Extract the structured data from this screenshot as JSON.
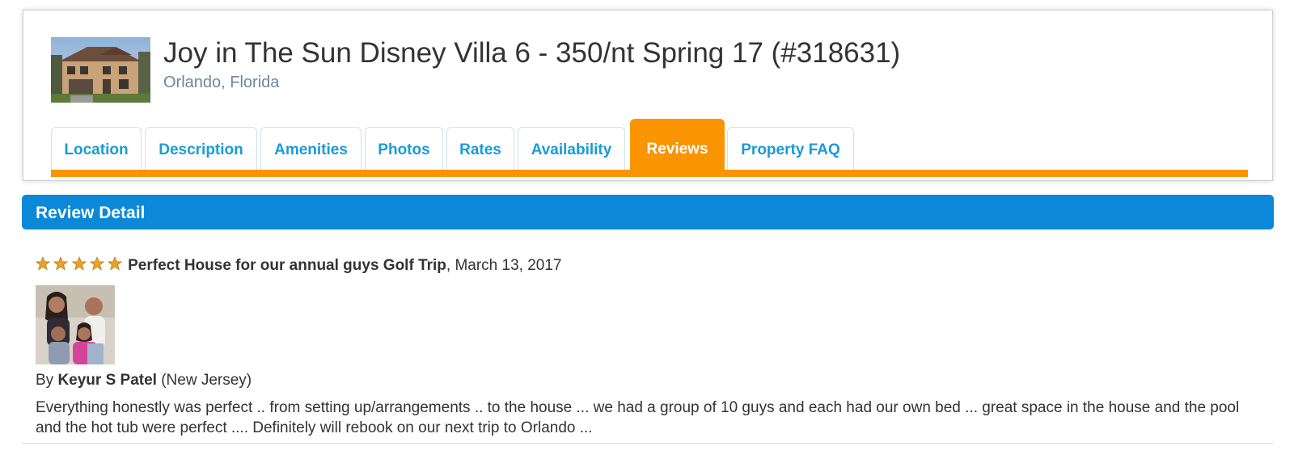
{
  "property": {
    "title": "Joy in The Sun Disney Villa 6 - 350/nt Spring 17 (#318631)",
    "location": "Orlando, Florida"
  },
  "tabs": [
    {
      "label": "Location",
      "active": false
    },
    {
      "label": "Description",
      "active": false
    },
    {
      "label": "Amenities",
      "active": false
    },
    {
      "label": "Photos",
      "active": false
    },
    {
      "label": "Rates",
      "active": false
    },
    {
      "label": "Availability",
      "active": false
    },
    {
      "label": "Reviews",
      "active": true
    },
    {
      "label": "Property FAQ",
      "active": false
    }
  ],
  "section": {
    "title": "Review Detail"
  },
  "review": {
    "rating": 5,
    "rating_max": 5,
    "title": "Perfect House for our annual guys Golf Trip",
    "date": ", March 13, 2017",
    "byline_prefix": "By ",
    "reviewer_name": "Keyur S Patel",
    "reviewer_location": " (New Jersey)",
    "body": "Everything honestly was perfect .. from setting up/arrangements .. to the house ... we had a group of 10 guys and each had our own bed ... great space in the house and the pool and the hot tub were perfect .... Definitely will rebook on our next trip to Orlando ..."
  },
  "colors": {
    "tab_text": "#1a9bd7",
    "tab_active_bg": "#fa9400",
    "section_bar_bg": "#0b88d8",
    "location_text": "#6d87a0",
    "star": "#e8a227"
  }
}
